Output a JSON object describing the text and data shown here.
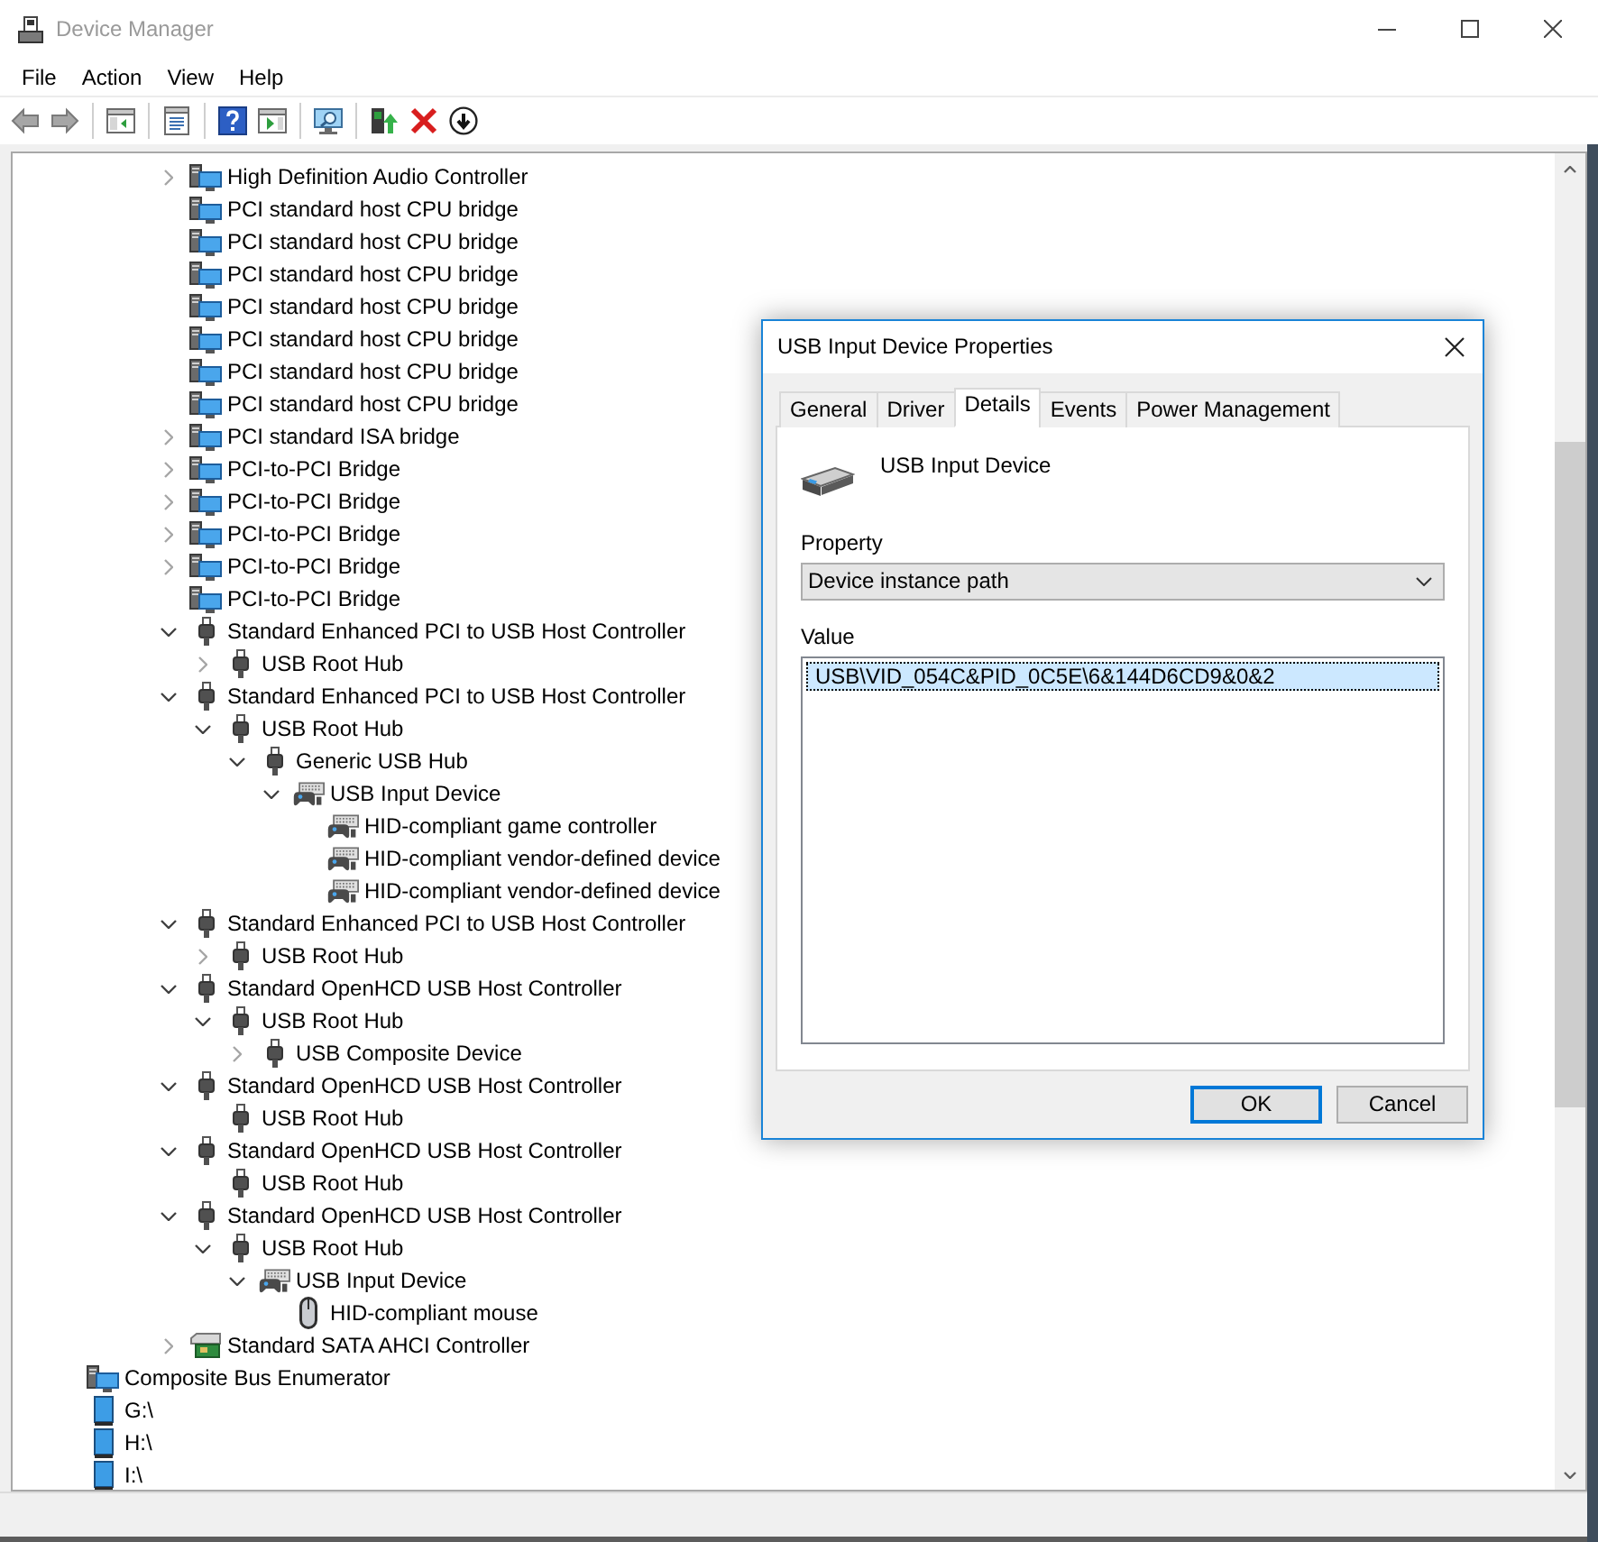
{
  "window": {
    "title": "Device Manager",
    "active": false
  },
  "menu": [
    "File",
    "Action",
    "View",
    "Help"
  ],
  "tree": {
    "items": [
      {
        "children": [
          {
            "children": [
              {
                "children": [
                  {
                    "label": "High Definition Audio Controller",
                    "kind": "system",
                    "expanded": false
                  },
                  {
                    "label": "PCI standard host CPU bridge",
                    "kind": "system"
                  },
                  {
                    "label": "PCI standard host CPU bridge",
                    "kind": "system"
                  },
                  {
                    "label": "PCI standard host CPU bridge",
                    "kind": "system"
                  },
                  {
                    "label": "PCI standard host CPU bridge",
                    "kind": "system"
                  },
                  {
                    "label": "PCI standard host CPU bridge",
                    "kind": "system"
                  },
                  {
                    "label": "PCI standard host CPU bridge",
                    "kind": "system"
                  },
                  {
                    "label": "PCI standard host CPU bridge",
                    "kind": "system"
                  },
                  {
                    "label": "PCI standard ISA bridge",
                    "kind": "system",
                    "expanded": false
                  },
                  {
                    "label": "PCI-to-PCI Bridge",
                    "kind": "system",
                    "expanded": false
                  },
                  {
                    "label": "PCI-to-PCI Bridge",
                    "kind": "system",
                    "expanded": false
                  },
                  {
                    "label": "PCI-to-PCI Bridge",
                    "kind": "system",
                    "expanded": false
                  },
                  {
                    "label": "PCI-to-PCI Bridge",
                    "kind": "system",
                    "expanded": false
                  },
                  {
                    "label": "PCI-to-PCI Bridge",
                    "kind": "system"
                  },
                  {
                    "label": "Standard Enhanced PCI to USB Host Controller",
                    "kind": "usb",
                    "expanded": true,
                    "children": [
                      {
                        "label": "USB Root Hub",
                        "kind": "usb",
                        "expanded": false
                      }
                    ]
                  },
                  {
                    "label": "Standard Enhanced PCI to USB Host Controller",
                    "kind": "usb",
                    "expanded": true,
                    "children": [
                      {
                        "label": "USB Root Hub",
                        "kind": "usb",
                        "expanded": true,
                        "children": [
                          {
                            "label": "Generic USB Hub",
                            "kind": "usb",
                            "expanded": true,
                            "children": [
                              {
                                "label": "USB Input Device",
                                "kind": "hid",
                                "expanded": true,
                                "children": [
                                  {
                                    "label": "HID-compliant game controller",
                                    "kind": "hid"
                                  },
                                  {
                                    "label": "HID-compliant vendor-defined device",
                                    "kind": "hid"
                                  },
                                  {
                                    "label": "HID-compliant vendor-defined device",
                                    "kind": "hid"
                                  }
                                ]
                              }
                            ]
                          }
                        ]
                      }
                    ]
                  },
                  {
                    "label": "Standard Enhanced PCI to USB Host Controller",
                    "kind": "usb",
                    "expanded": true,
                    "children": [
                      {
                        "label": "USB Root Hub",
                        "kind": "usb",
                        "expanded": false
                      }
                    ]
                  },
                  {
                    "label": "Standard OpenHCD USB Host Controller",
                    "kind": "usb",
                    "expanded": true,
                    "children": [
                      {
                        "label": "USB Root Hub",
                        "kind": "usb",
                        "expanded": true,
                        "children": [
                          {
                            "label": "USB Composite Device",
                            "kind": "usb",
                            "expanded": false
                          }
                        ]
                      }
                    ]
                  },
                  {
                    "label": "Standard OpenHCD USB Host Controller",
                    "kind": "usb",
                    "expanded": true,
                    "children": [
                      {
                        "label": "USB Root Hub",
                        "kind": "usb"
                      }
                    ]
                  },
                  {
                    "label": "Standard OpenHCD USB Host Controller",
                    "kind": "usb",
                    "expanded": true,
                    "children": [
                      {
                        "label": "USB Root Hub",
                        "kind": "usb"
                      }
                    ]
                  },
                  {
                    "label": "Standard OpenHCD USB Host Controller",
                    "kind": "usb",
                    "expanded": true,
                    "children": [
                      {
                        "label": "USB Root Hub",
                        "kind": "usb",
                        "expanded": true,
                        "children": [
                          {
                            "label": "USB Input Device",
                            "kind": "hid",
                            "expanded": true,
                            "children": [
                              {
                                "label": "HID-compliant mouse",
                                "kind": "mouse"
                              }
                            ]
                          }
                        ]
                      }
                    ]
                  },
                  {
                    "label": "Standard SATA AHCI Controller",
                    "kind": "storage",
                    "expanded": false
                  }
                ]
              }
            ]
          }
        ]
      },
      {
        "label": "Composite Bus Enumerator",
        "kind": "system"
      },
      {
        "label": "G:\\",
        "kind": "volume"
      },
      {
        "label": "H:\\",
        "kind": "volume"
      },
      {
        "label": "I:\\",
        "kind": "volume"
      }
    ]
  },
  "dialog": {
    "title": "USB Input Device Properties",
    "active": true,
    "tabs": [
      {
        "label": "General",
        "selected": false
      },
      {
        "label": "Driver",
        "selected": false
      },
      {
        "label": "Details",
        "selected": true
      },
      {
        "label": "Events",
        "selected": false
      },
      {
        "label": "Power Management",
        "selected": false
      }
    ],
    "device_name": "USB Input Device",
    "property_label": "Property",
    "property": "Device instance path",
    "value_label": "Value",
    "values": [
      {
        "text": "USB\\VID_054C&PID_0C5E\\6&144D6CD9&0&2",
        "selected": true
      }
    ],
    "buttons": [
      {
        "label": "OK",
        "default": true
      },
      {
        "label": "Cancel",
        "default": false
      }
    ]
  }
}
